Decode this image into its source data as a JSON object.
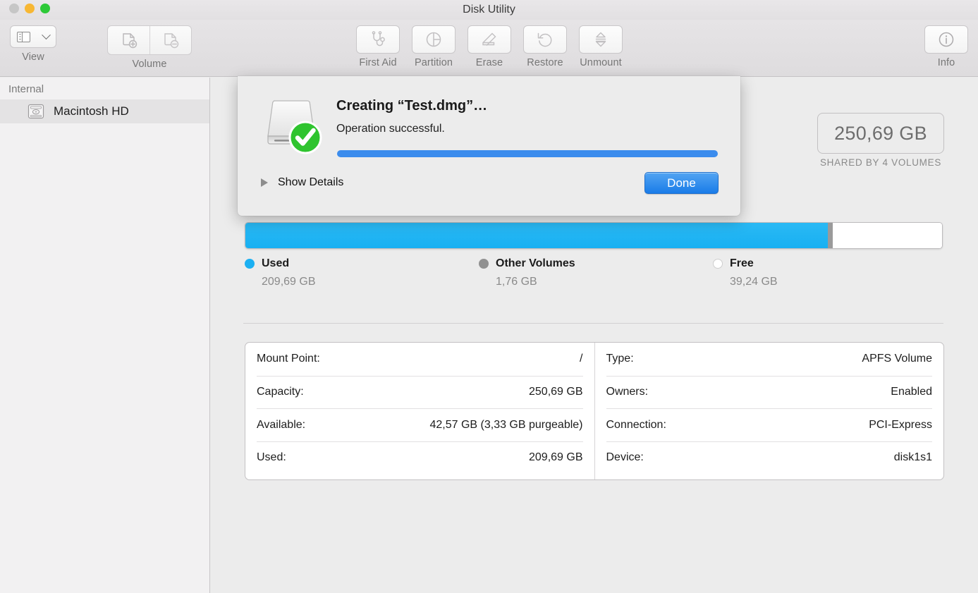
{
  "window": {
    "title": "Disk Utility",
    "traffic_lights": [
      "close",
      "minimize",
      "maximize"
    ]
  },
  "toolbar": {
    "view": {
      "label": "View",
      "icon": "sidebar-icon",
      "chevron": "chevron-down-icon"
    },
    "volume": {
      "label": "Volume",
      "buttons": [
        {
          "name": "add-volume",
          "icon": "volume-add-icon"
        },
        {
          "name": "remove-volume",
          "icon": "volume-remove-icon"
        }
      ]
    },
    "actions": [
      {
        "label": "First Aid",
        "icon": "stethoscope-icon"
      },
      {
        "label": "Partition",
        "icon": "pie-chart-icon"
      },
      {
        "label": "Erase",
        "icon": "erase-icon"
      },
      {
        "label": "Restore",
        "icon": "restore-icon"
      },
      {
        "label": "Unmount",
        "icon": "eject-icon"
      }
    ],
    "info": {
      "label": "Info",
      "icon": "info-circle-icon"
    }
  },
  "sidebar": {
    "header": "Internal",
    "items": [
      {
        "label": "Macintosh HD",
        "icon": "hard-drive-icon",
        "selected": true
      }
    ]
  },
  "main": {
    "capacity": {
      "value": "250,69 GB",
      "subtitle": "SHARED BY 4 VOLUMES"
    },
    "legend": [
      {
        "name": "Used",
        "value": "209,69 GB",
        "color": "#1cb0f2"
      },
      {
        "name": "Other Volumes",
        "value": "1,76 GB",
        "color": "#919191"
      },
      {
        "name": "Free",
        "value": "39,24 GB",
        "color": "#ffffff"
      }
    ],
    "info_left": [
      {
        "label": "Mount Point:",
        "value": "/"
      },
      {
        "label": "Capacity:",
        "value": "250,69 GB"
      },
      {
        "label": "Available:",
        "value": "42,57 GB (3,33 GB purgeable)"
      },
      {
        "label": "Used:",
        "value": "209,69 GB"
      }
    ],
    "info_right": [
      {
        "label": "Type:",
        "value": "APFS Volume"
      },
      {
        "label": "Owners:",
        "value": "Enabled"
      },
      {
        "label": "Connection:",
        "value": "PCI-Express"
      },
      {
        "label": "Device:",
        "value": "disk1s1"
      }
    ]
  },
  "dialog": {
    "title": "Creating “Test.dmg”…",
    "message": "Operation successful.",
    "progress_percent": 100,
    "disclosure_label": "Show Details",
    "primary_button": "Done",
    "icon": "disk-success-icon"
  },
  "chart_data": {
    "type": "bar",
    "title": "Disk capacity usage",
    "categories": [
      "Used",
      "Other Volumes",
      "Free"
    ],
    "values": [
      209.69,
      1.76,
      39.24
    ],
    "unit": "GB",
    "total": 250.69,
    "colors": [
      "#1cb0f2",
      "#919191",
      "#ffffff"
    ],
    "orientation": "horizontal-stacked",
    "legend": "bottom"
  }
}
